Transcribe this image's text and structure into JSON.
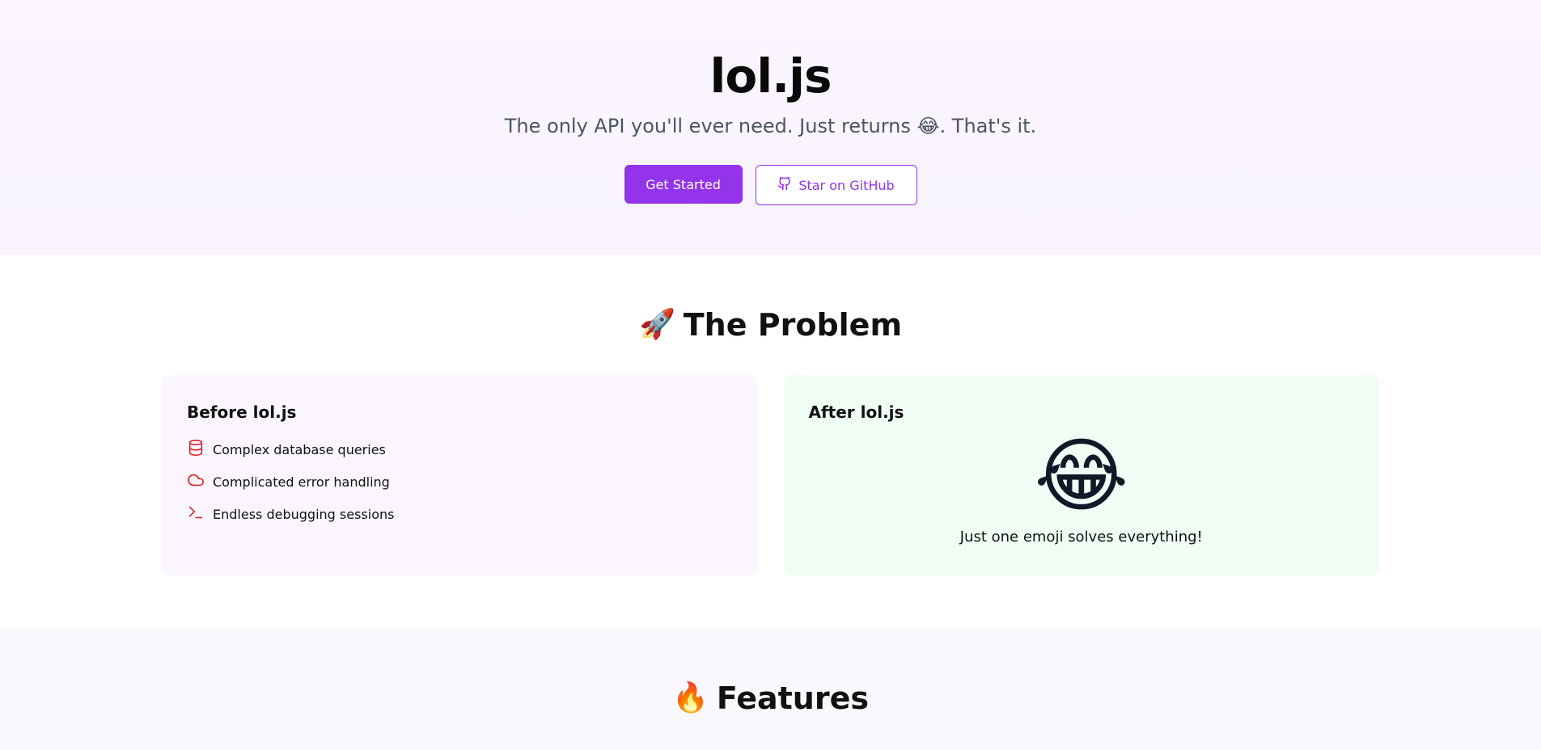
{
  "hero": {
    "title": "lol.js",
    "subtitle": "The only API you'll ever need. Just returns 😂. That's it.",
    "get_started_label": "Get Started",
    "github_label": "Star on GitHub"
  },
  "problem": {
    "emoji": "🚀",
    "title": "The Problem",
    "before": {
      "title": "Before lol.js",
      "items": [
        {
          "label": "Complex database queries",
          "icon": "database-icon"
        },
        {
          "label": "Complicated error handling",
          "icon": "cloud-icon"
        },
        {
          "label": "Endless debugging sessions",
          "icon": "terminal-icon"
        }
      ]
    },
    "after": {
      "title": "After lol.js",
      "emoji": "😂",
      "caption": "Just one emoji solves everything!"
    }
  },
  "features": {
    "emoji": "🔥",
    "title": "Features"
  },
  "colors": {
    "accent": "#9333ea",
    "icon_red": "#dc2626",
    "before_bg": "#faf5ff",
    "after_bg": "#f0fdf4"
  }
}
